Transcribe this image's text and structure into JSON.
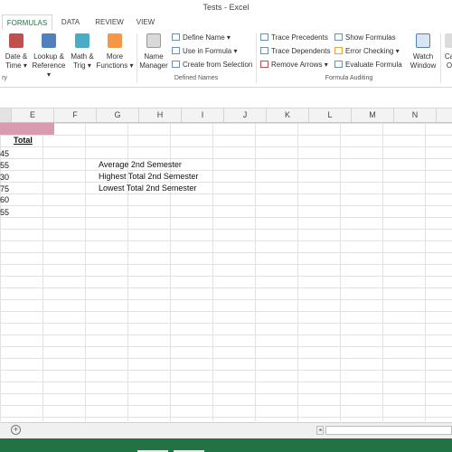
{
  "window": {
    "title": "Tests - Excel"
  },
  "tabs": [
    {
      "label": "FORMULAS",
      "active": true
    },
    {
      "label": "DATA",
      "active": false
    },
    {
      "label": "REVIEW",
      "active": false
    },
    {
      "label": "VIEW",
      "active": false
    }
  ],
  "ribbon": {
    "function_library": {
      "group_label": "ry",
      "date_time": {
        "line1": "Date &",
        "line2": "Time"
      },
      "lookup_reference": {
        "line1": "Lookup &",
        "line2": "Reference"
      },
      "math_trig": {
        "line1": "Math &",
        "line2": "Trig"
      },
      "more_functions": {
        "line1": "More",
        "line2": "Functions"
      }
    },
    "defined_names": {
      "group_label": "Defined Names",
      "name_manager": {
        "line1": "Name",
        "line2": "Manager"
      },
      "define_name": "Define Name",
      "use_in_formula": "Use in Formula",
      "create_from_selection": "Create from Selection"
    },
    "formula_auditing": {
      "group_label": "Formula Auditing",
      "trace_precedents": "Trace Precedents",
      "trace_dependents": "Trace Dependents",
      "remove_arrows": "Remove Arrows",
      "show_formulas": "Show Formulas",
      "error_checking": "Error Checking",
      "evaluate_formula": "Evaluate Formula",
      "watch_window": {
        "line1": "Watch",
        "line2": "Window"
      },
      "calc_partial": {
        "line1": "Ca",
        "line2": "O"
      }
    }
  },
  "columns": [
    "E",
    "F",
    "G",
    "H",
    "I",
    "J",
    "K",
    "L",
    "M",
    "N"
  ],
  "cells": {
    "e_header": "Total",
    "d_values": [
      "45",
      "55",
      "30",
      "75",
      "60",
      "55"
    ],
    "g_labels": [
      "Average 2nd Semester",
      "Highest Total 2nd Semester",
      "Lowest Total 2nd Semester"
    ]
  },
  "colors": {
    "accent": "#217346",
    "highlight_cell": "#d99bb0"
  }
}
